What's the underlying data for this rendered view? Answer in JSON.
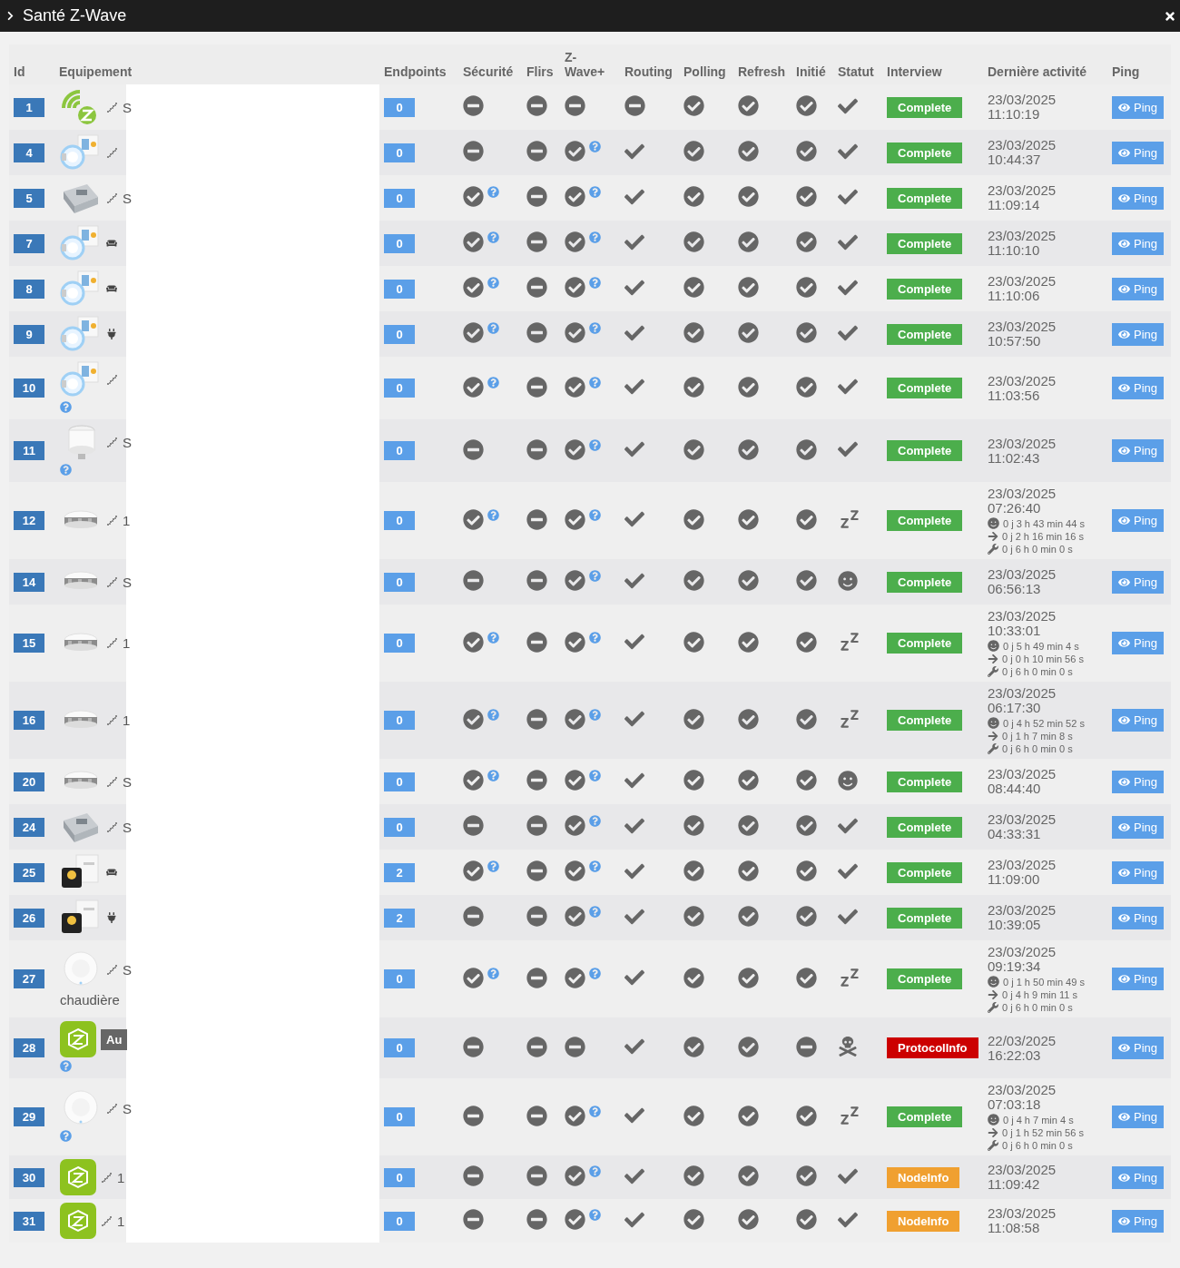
{
  "window": {
    "title": "Santé Z-Wave"
  },
  "columns": [
    "Id",
    "Equipement",
    "Endpoints",
    "Sécurité",
    "Flirs",
    "Z-Wave+",
    "Routing",
    "Polling",
    "Refresh",
    "Initié",
    "Statut",
    "Interview",
    "Dernière activité",
    "Ping"
  ],
  "rows": [
    {
      "id": "1",
      "picture": {
        "kind": "zwave"
      },
      "glyph": {
        "kind": "zigzag"
      },
      "name": "S",
      "help": false,
      "endpoints": "0",
      "security": {
        "kind": "no",
        "help": false
      },
      "flirs": {
        "kind": "no"
      },
      "zwave_plus": {
        "kind": "no",
        "help": false
      },
      "routing": {
        "kind": "no"
      },
      "polling": {
        "kind": "yes"
      },
      "refresh": {
        "kind": "yes"
      },
      "initiated": {
        "kind": "yes"
      },
      "status": {
        "kind": "check"
      },
      "interview": {
        "label": "Complete",
        "color": "#4cae4c"
      },
      "date": "23/03/2025",
      "time": "11:10:19",
      "ping": "Ping"
    },
    {
      "id": "4",
      "picture": {
        "kind": "plug"
      },
      "glyph": {
        "kind": "zigzag"
      },
      "help": false,
      "endpoints": "0",
      "security": {
        "kind": "no",
        "help": false
      },
      "flirs": {
        "kind": "no"
      },
      "zwave_plus": {
        "kind": "yes",
        "help": true
      },
      "routing": {
        "kind": "check"
      },
      "polling": {
        "kind": "yes"
      },
      "refresh": {
        "kind": "yes"
      },
      "initiated": {
        "kind": "yes"
      },
      "status": {
        "kind": "check"
      },
      "interview": {
        "label": "Complete",
        "color": "#4cae4c"
      },
      "date": "23/03/2025",
      "time": "10:44:37",
      "ping": "Ping"
    },
    {
      "id": "5",
      "picture": {
        "kind": "module"
      },
      "glyph": {
        "kind": "zigzag"
      },
      "name": "S",
      "help": false,
      "endpoints": "0",
      "security": {
        "kind": "yes",
        "help": true
      },
      "flirs": {
        "kind": "no"
      },
      "zwave_plus": {
        "kind": "yes",
        "help": true
      },
      "routing": {
        "kind": "check"
      },
      "polling": {
        "kind": "yes"
      },
      "refresh": {
        "kind": "yes"
      },
      "initiated": {
        "kind": "yes"
      },
      "status": {
        "kind": "check"
      },
      "interview": {
        "label": "Complete",
        "color": "#4cae4c"
      },
      "date": "23/03/2025",
      "time": "11:09:14",
      "ping": "Ping"
    },
    {
      "id": "7",
      "picture": {
        "kind": "plug"
      },
      "glyph": {
        "kind": "sofa"
      },
      "help": false,
      "endpoints": "0",
      "security": {
        "kind": "yes",
        "help": true
      },
      "flirs": {
        "kind": "no"
      },
      "zwave_plus": {
        "kind": "yes",
        "help": true
      },
      "routing": {
        "kind": "check"
      },
      "polling": {
        "kind": "yes"
      },
      "refresh": {
        "kind": "yes"
      },
      "initiated": {
        "kind": "yes"
      },
      "status": {
        "kind": "check"
      },
      "interview": {
        "label": "Complete",
        "color": "#4cae4c"
      },
      "date": "23/03/2025",
      "time": "11:10:10",
      "ping": "Ping"
    },
    {
      "id": "8",
      "picture": {
        "kind": "plug"
      },
      "glyph": {
        "kind": "sofa"
      },
      "help": false,
      "endpoints": "0",
      "security": {
        "kind": "yes",
        "help": true
      },
      "flirs": {
        "kind": "no"
      },
      "zwave_plus": {
        "kind": "yes",
        "help": true
      },
      "routing": {
        "kind": "check"
      },
      "polling": {
        "kind": "yes"
      },
      "refresh": {
        "kind": "yes"
      },
      "initiated": {
        "kind": "yes"
      },
      "status": {
        "kind": "check"
      },
      "interview": {
        "label": "Complete",
        "color": "#4cae4c"
      },
      "date": "23/03/2025",
      "time": "11:10:06",
      "ping": "Ping"
    },
    {
      "id": "9",
      "picture": {
        "kind": "plug"
      },
      "glyph": {
        "kind": "plug"
      },
      "help": false,
      "endpoints": "0",
      "security": {
        "kind": "yes",
        "help": true
      },
      "flirs": {
        "kind": "no"
      },
      "zwave_plus": {
        "kind": "yes",
        "help": true
      },
      "routing": {
        "kind": "check"
      },
      "polling": {
        "kind": "yes"
      },
      "refresh": {
        "kind": "yes"
      },
      "initiated": {
        "kind": "yes"
      },
      "status": {
        "kind": "check"
      },
      "interview": {
        "label": "Complete",
        "color": "#4cae4c"
      },
      "date": "23/03/2025",
      "time": "10:57:50",
      "ping": "Ping"
    },
    {
      "id": "10",
      "picture": {
        "kind": "plug"
      },
      "glyph": {
        "kind": "zigzag"
      },
      "help": true,
      "endpoints": "0",
      "security": {
        "kind": "yes",
        "help": true
      },
      "flirs": {
        "kind": "no"
      },
      "zwave_plus": {
        "kind": "yes",
        "help": true
      },
      "routing": {
        "kind": "check"
      },
      "polling": {
        "kind": "yes"
      },
      "refresh": {
        "kind": "yes"
      },
      "initiated": {
        "kind": "yes"
      },
      "status": {
        "kind": "check"
      },
      "interview": {
        "label": "Complete",
        "color": "#4cae4c"
      },
      "date": "23/03/2025",
      "time": "11:03:56",
      "ping": "Ping"
    },
    {
      "id": "11",
      "picture": {
        "kind": "valve"
      },
      "glyph": {
        "kind": "zigzag"
      },
      "name": "S",
      "help": true,
      "endpoints": "0",
      "security": {
        "kind": "no",
        "help": false
      },
      "flirs": {
        "kind": "no"
      },
      "zwave_plus": {
        "kind": "yes",
        "help": true
      },
      "routing": {
        "kind": "check"
      },
      "polling": {
        "kind": "yes"
      },
      "refresh": {
        "kind": "yes"
      },
      "initiated": {
        "kind": "yes"
      },
      "status": {
        "kind": "check"
      },
      "interview": {
        "label": "Complete",
        "color": "#4cae4c"
      },
      "date": "23/03/2025",
      "time": "11:02:43",
      "ping": "Ping"
    },
    {
      "id": "12",
      "picture": {
        "kind": "smoke"
      },
      "glyph": {
        "kind": "zigzag"
      },
      "name": "1",
      "help": false,
      "endpoints": "0",
      "security": {
        "kind": "yes",
        "help": true
      },
      "flirs": {
        "kind": "no"
      },
      "zwave_plus": {
        "kind": "yes",
        "help": true
      },
      "routing": {
        "kind": "check"
      },
      "polling": {
        "kind": "yes"
      },
      "refresh": {
        "kind": "yes"
      },
      "initiated": {
        "kind": "yes"
      },
      "status": {
        "kind": "sleep"
      },
      "interview": {
        "label": "Complete",
        "color": "#4cae4c"
      },
      "date": "23/03/2025",
      "time": "07:26:40",
      "durations": [
        {
          "kind": "awake",
          "text": "0 j 3 h 43 min 44 s"
        },
        {
          "kind": "next",
          "text": "0 j 2 h 16 min 16 s"
        },
        {
          "kind": "interval",
          "text": "0 j 6 h 0 min 0 s"
        }
      ],
      "ping": "Ping"
    },
    {
      "id": "14",
      "picture": {
        "kind": "smoke"
      },
      "glyph": {
        "kind": "zigzag"
      },
      "name": "S",
      "help": false,
      "endpoints": "0",
      "security": {
        "kind": "no",
        "help": false
      },
      "flirs": {
        "kind": "no"
      },
      "zwave_plus": {
        "kind": "yes",
        "help": true
      },
      "routing": {
        "kind": "check"
      },
      "polling": {
        "kind": "yes"
      },
      "refresh": {
        "kind": "yes"
      },
      "initiated": {
        "kind": "yes"
      },
      "status": {
        "kind": "awake"
      },
      "interview": {
        "label": "Complete",
        "color": "#4cae4c"
      },
      "date": "23/03/2025",
      "time": "06:56:13",
      "ping": "Ping"
    },
    {
      "id": "15",
      "picture": {
        "kind": "smoke"
      },
      "glyph": {
        "kind": "zigzag"
      },
      "name": "1",
      "help": false,
      "endpoints": "0",
      "security": {
        "kind": "yes",
        "help": true
      },
      "flirs": {
        "kind": "no"
      },
      "zwave_plus": {
        "kind": "yes",
        "help": true
      },
      "routing": {
        "kind": "check"
      },
      "polling": {
        "kind": "yes"
      },
      "refresh": {
        "kind": "yes"
      },
      "initiated": {
        "kind": "yes"
      },
      "status": {
        "kind": "sleep"
      },
      "interview": {
        "label": "Complete",
        "color": "#4cae4c"
      },
      "date": "23/03/2025",
      "time": "10:33:01",
      "durations": [
        {
          "kind": "awake",
          "text": "0 j 5 h 49 min 4 s"
        },
        {
          "kind": "next",
          "text": "0 j 0 h 10 min 56 s"
        },
        {
          "kind": "interval",
          "text": "0 j 6 h 0 min 0 s"
        }
      ],
      "ping": "Ping"
    },
    {
      "id": "16",
      "picture": {
        "kind": "smoke"
      },
      "glyph": {
        "kind": "zigzag"
      },
      "name": "1",
      "help": false,
      "endpoints": "0",
      "security": {
        "kind": "yes",
        "help": true
      },
      "flirs": {
        "kind": "no"
      },
      "zwave_plus": {
        "kind": "yes",
        "help": true
      },
      "routing": {
        "kind": "check"
      },
      "polling": {
        "kind": "yes"
      },
      "refresh": {
        "kind": "yes"
      },
      "initiated": {
        "kind": "yes"
      },
      "status": {
        "kind": "sleep"
      },
      "interview": {
        "label": "Complete",
        "color": "#4cae4c"
      },
      "date": "23/03/2025",
      "time": "06:17:30",
      "durations": [
        {
          "kind": "awake",
          "text": "0 j 4 h 52 min 52 s"
        },
        {
          "kind": "next",
          "text": "0 j 1 h 7 min 8 s"
        },
        {
          "kind": "interval",
          "text": "0 j 6 h 0 min 0 s"
        }
      ],
      "ping": "Ping"
    },
    {
      "id": "20",
      "picture": {
        "kind": "smoke"
      },
      "glyph": {
        "kind": "zigzag"
      },
      "name": "S",
      "help": false,
      "endpoints": "0",
      "security": {
        "kind": "yes",
        "help": true
      },
      "flirs": {
        "kind": "no"
      },
      "zwave_plus": {
        "kind": "yes",
        "help": true
      },
      "routing": {
        "kind": "check"
      },
      "polling": {
        "kind": "yes"
      },
      "refresh": {
        "kind": "yes"
      },
      "initiated": {
        "kind": "yes"
      },
      "status": {
        "kind": "awake"
      },
      "interview": {
        "label": "Complete",
        "color": "#4cae4c"
      },
      "date": "23/03/2025",
      "time": "08:44:40",
      "ping": "Ping"
    },
    {
      "id": "24",
      "picture": {
        "kind": "module"
      },
      "glyph": {
        "kind": "zigzag"
      },
      "name": "S",
      "help": false,
      "endpoints": "0",
      "security": {
        "kind": "no",
        "help": false
      },
      "flirs": {
        "kind": "no"
      },
      "zwave_plus": {
        "kind": "yes",
        "help": true
      },
      "routing": {
        "kind": "check"
      },
      "polling": {
        "kind": "yes"
      },
      "refresh": {
        "kind": "yes"
      },
      "initiated": {
        "kind": "yes"
      },
      "status": {
        "kind": "check"
      },
      "interview": {
        "label": "Complete",
        "color": "#4cae4c"
      },
      "date": "23/03/2025",
      "time": "04:33:31",
      "ping": "Ping"
    },
    {
      "id": "25",
      "picture": {
        "kind": "box"
      },
      "glyph": {
        "kind": "sofa"
      },
      "help": false,
      "endpoints": "2",
      "security": {
        "kind": "yes",
        "help": true
      },
      "flirs": {
        "kind": "no"
      },
      "zwave_plus": {
        "kind": "yes",
        "help": true
      },
      "routing": {
        "kind": "check"
      },
      "polling": {
        "kind": "yes"
      },
      "refresh": {
        "kind": "yes"
      },
      "initiated": {
        "kind": "yes"
      },
      "status": {
        "kind": "check"
      },
      "interview": {
        "label": "Complete",
        "color": "#4cae4c"
      },
      "date": "23/03/2025",
      "time": "11:09:00",
      "ping": "Ping"
    },
    {
      "id": "26",
      "picture": {
        "kind": "box"
      },
      "glyph": {
        "kind": "plug"
      },
      "help": false,
      "endpoints": "2",
      "security": {
        "kind": "no",
        "help": false
      },
      "flirs": {
        "kind": "no"
      },
      "zwave_plus": {
        "kind": "yes",
        "help": true
      },
      "routing": {
        "kind": "check"
      },
      "polling": {
        "kind": "yes"
      },
      "refresh": {
        "kind": "yes"
      },
      "initiated": {
        "kind": "yes"
      },
      "status": {
        "kind": "check"
      },
      "interview": {
        "label": "Complete",
        "color": "#4cae4c"
      },
      "date": "23/03/2025",
      "time": "10:39:05",
      "ping": "Ping"
    },
    {
      "id": "27",
      "picture": {
        "kind": "disc"
      },
      "glyph": {
        "kind": "zigzag"
      },
      "name": "S",
      "note": "chaudière",
      "help": false,
      "endpoints": "0",
      "security": {
        "kind": "yes",
        "help": true
      },
      "flirs": {
        "kind": "no"
      },
      "zwave_plus": {
        "kind": "yes",
        "help": true
      },
      "routing": {
        "kind": "check"
      },
      "polling": {
        "kind": "yes"
      },
      "refresh": {
        "kind": "yes"
      },
      "initiated": {
        "kind": "yes"
      },
      "status": {
        "kind": "sleep"
      },
      "interview": {
        "label": "Complete",
        "color": "#4cae4c"
      },
      "date": "23/03/2025",
      "time": "09:19:34",
      "durations": [
        {
          "kind": "awake",
          "text": "0 j 1 h 50 min 49 s"
        },
        {
          "kind": "next",
          "text": "0 j 4 h 9 min 11 s"
        },
        {
          "kind": "interval",
          "text": "0 j 6 h 0 min 0 s"
        }
      ],
      "ping": "Ping"
    },
    {
      "id": "28",
      "picture": {
        "kind": "zbox"
      },
      "badge": "Au",
      "help": true,
      "endpoints": "0",
      "security": {
        "kind": "no",
        "help": false
      },
      "flirs": {
        "kind": "no"
      },
      "zwave_plus": {
        "kind": "no",
        "help": false
      },
      "routing": {
        "kind": "check"
      },
      "polling": {
        "kind": "yes"
      },
      "refresh": {
        "kind": "yes"
      },
      "initiated": {
        "kind": "no"
      },
      "status": {
        "kind": "dead"
      },
      "interview": {
        "label": "ProtocolInfo",
        "color": "#cc0000"
      },
      "date": "22/03/2025",
      "time": "16:22:03",
      "ping": "Ping"
    },
    {
      "id": "29",
      "picture": {
        "kind": "disc"
      },
      "glyph": {
        "kind": "zigzag"
      },
      "name": "S",
      "help": true,
      "endpoints": "0",
      "security": {
        "kind": "no",
        "help": false
      },
      "flirs": {
        "kind": "no"
      },
      "zwave_plus": {
        "kind": "yes",
        "help": true
      },
      "routing": {
        "kind": "check"
      },
      "polling": {
        "kind": "yes"
      },
      "refresh": {
        "kind": "yes"
      },
      "initiated": {
        "kind": "yes"
      },
      "status": {
        "kind": "sleep"
      },
      "interview": {
        "label": "Complete",
        "color": "#4cae4c"
      },
      "date": "23/03/2025",
      "time": "07:03:18",
      "durations": [
        {
          "kind": "awake",
          "text": "0 j 4 h 7 min 4 s"
        },
        {
          "kind": "next",
          "text": "0 j 1 h 52 min 56 s"
        },
        {
          "kind": "interval",
          "text": "0 j 6 h 0 min 0 s"
        }
      ],
      "ping": "Ping"
    },
    {
      "id": "30",
      "picture": {
        "kind": "zbox"
      },
      "glyph": {
        "kind": "zigzag"
      },
      "name": "1",
      "help": false,
      "endpoints": "0",
      "security": {
        "kind": "no",
        "help": false
      },
      "flirs": {
        "kind": "no"
      },
      "zwave_plus": {
        "kind": "yes",
        "help": true
      },
      "routing": {
        "kind": "check"
      },
      "polling": {
        "kind": "yes"
      },
      "refresh": {
        "kind": "yes"
      },
      "initiated": {
        "kind": "yes"
      },
      "status": {
        "kind": "check"
      },
      "interview": {
        "label": "NodeInfo",
        "color": "#f0a030"
      },
      "date": "23/03/2025",
      "time": "11:09:42",
      "ping": "Ping"
    },
    {
      "id": "31",
      "picture": {
        "kind": "zbox"
      },
      "glyph": {
        "kind": "zigzag"
      },
      "name": "1",
      "help": false,
      "endpoints": "0",
      "security": {
        "kind": "no",
        "help": false
      },
      "flirs": {
        "kind": "no"
      },
      "zwave_plus": {
        "kind": "yes",
        "help": true
      },
      "routing": {
        "kind": "check"
      },
      "polling": {
        "kind": "yes"
      },
      "refresh": {
        "kind": "yes"
      },
      "initiated": {
        "kind": "yes"
      },
      "status": {
        "kind": "check"
      },
      "interview": {
        "label": "NodeInfo",
        "color": "#f0a030"
      },
      "date": "23/03/2025",
      "time": "11:08:58",
      "ping": "Ping"
    }
  ]
}
